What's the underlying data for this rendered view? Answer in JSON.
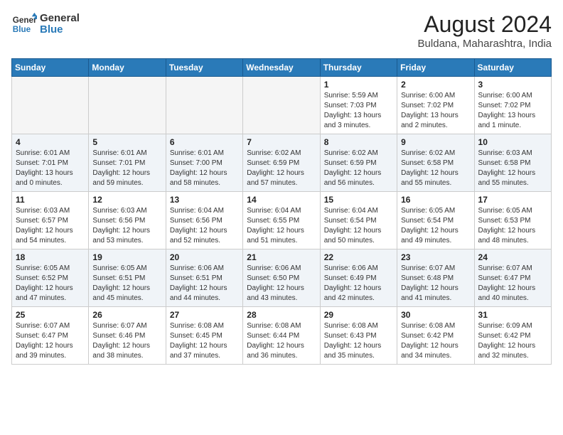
{
  "header": {
    "logo_line1": "General",
    "logo_line2": "Blue",
    "title": "August 2024",
    "subtitle": "Buldana, Maharashtra, India"
  },
  "weekdays": [
    "Sunday",
    "Monday",
    "Tuesday",
    "Wednesday",
    "Thursday",
    "Friday",
    "Saturday"
  ],
  "weeks": [
    [
      {
        "day": "",
        "detail": ""
      },
      {
        "day": "",
        "detail": ""
      },
      {
        "day": "",
        "detail": ""
      },
      {
        "day": "",
        "detail": ""
      },
      {
        "day": "1",
        "detail": "Sunrise: 5:59 AM\nSunset: 7:03 PM\nDaylight: 13 hours\nand 3 minutes."
      },
      {
        "day": "2",
        "detail": "Sunrise: 6:00 AM\nSunset: 7:02 PM\nDaylight: 13 hours\nand 2 minutes."
      },
      {
        "day": "3",
        "detail": "Sunrise: 6:00 AM\nSunset: 7:02 PM\nDaylight: 13 hours\nand 1 minute."
      }
    ],
    [
      {
        "day": "4",
        "detail": "Sunrise: 6:01 AM\nSunset: 7:01 PM\nDaylight: 13 hours\nand 0 minutes."
      },
      {
        "day": "5",
        "detail": "Sunrise: 6:01 AM\nSunset: 7:01 PM\nDaylight: 12 hours\nand 59 minutes."
      },
      {
        "day": "6",
        "detail": "Sunrise: 6:01 AM\nSunset: 7:00 PM\nDaylight: 12 hours\nand 58 minutes."
      },
      {
        "day": "7",
        "detail": "Sunrise: 6:02 AM\nSunset: 6:59 PM\nDaylight: 12 hours\nand 57 minutes."
      },
      {
        "day": "8",
        "detail": "Sunrise: 6:02 AM\nSunset: 6:59 PM\nDaylight: 12 hours\nand 56 minutes."
      },
      {
        "day": "9",
        "detail": "Sunrise: 6:02 AM\nSunset: 6:58 PM\nDaylight: 12 hours\nand 55 minutes."
      },
      {
        "day": "10",
        "detail": "Sunrise: 6:03 AM\nSunset: 6:58 PM\nDaylight: 12 hours\nand 55 minutes."
      }
    ],
    [
      {
        "day": "11",
        "detail": "Sunrise: 6:03 AM\nSunset: 6:57 PM\nDaylight: 12 hours\nand 54 minutes."
      },
      {
        "day": "12",
        "detail": "Sunrise: 6:03 AM\nSunset: 6:56 PM\nDaylight: 12 hours\nand 53 minutes."
      },
      {
        "day": "13",
        "detail": "Sunrise: 6:04 AM\nSunset: 6:56 PM\nDaylight: 12 hours\nand 52 minutes."
      },
      {
        "day": "14",
        "detail": "Sunrise: 6:04 AM\nSunset: 6:55 PM\nDaylight: 12 hours\nand 51 minutes."
      },
      {
        "day": "15",
        "detail": "Sunrise: 6:04 AM\nSunset: 6:54 PM\nDaylight: 12 hours\nand 50 minutes."
      },
      {
        "day": "16",
        "detail": "Sunrise: 6:05 AM\nSunset: 6:54 PM\nDaylight: 12 hours\nand 49 minutes."
      },
      {
        "day": "17",
        "detail": "Sunrise: 6:05 AM\nSunset: 6:53 PM\nDaylight: 12 hours\nand 48 minutes."
      }
    ],
    [
      {
        "day": "18",
        "detail": "Sunrise: 6:05 AM\nSunset: 6:52 PM\nDaylight: 12 hours\nand 47 minutes."
      },
      {
        "day": "19",
        "detail": "Sunrise: 6:05 AM\nSunset: 6:51 PM\nDaylight: 12 hours\nand 45 minutes."
      },
      {
        "day": "20",
        "detail": "Sunrise: 6:06 AM\nSunset: 6:51 PM\nDaylight: 12 hours\nand 44 minutes."
      },
      {
        "day": "21",
        "detail": "Sunrise: 6:06 AM\nSunset: 6:50 PM\nDaylight: 12 hours\nand 43 minutes."
      },
      {
        "day": "22",
        "detail": "Sunrise: 6:06 AM\nSunset: 6:49 PM\nDaylight: 12 hours\nand 42 minutes."
      },
      {
        "day": "23",
        "detail": "Sunrise: 6:07 AM\nSunset: 6:48 PM\nDaylight: 12 hours\nand 41 minutes."
      },
      {
        "day": "24",
        "detail": "Sunrise: 6:07 AM\nSunset: 6:47 PM\nDaylight: 12 hours\nand 40 minutes."
      }
    ],
    [
      {
        "day": "25",
        "detail": "Sunrise: 6:07 AM\nSunset: 6:47 PM\nDaylight: 12 hours\nand 39 minutes."
      },
      {
        "day": "26",
        "detail": "Sunrise: 6:07 AM\nSunset: 6:46 PM\nDaylight: 12 hours\nand 38 minutes."
      },
      {
        "day": "27",
        "detail": "Sunrise: 6:08 AM\nSunset: 6:45 PM\nDaylight: 12 hours\nand 37 minutes."
      },
      {
        "day": "28",
        "detail": "Sunrise: 6:08 AM\nSunset: 6:44 PM\nDaylight: 12 hours\nand 36 minutes."
      },
      {
        "day": "29",
        "detail": "Sunrise: 6:08 AM\nSunset: 6:43 PM\nDaylight: 12 hours\nand 35 minutes."
      },
      {
        "day": "30",
        "detail": "Sunrise: 6:08 AM\nSunset: 6:42 PM\nDaylight: 12 hours\nand 34 minutes."
      },
      {
        "day": "31",
        "detail": "Sunrise: 6:09 AM\nSunset: 6:42 PM\nDaylight: 12 hours\nand 32 minutes."
      }
    ]
  ]
}
